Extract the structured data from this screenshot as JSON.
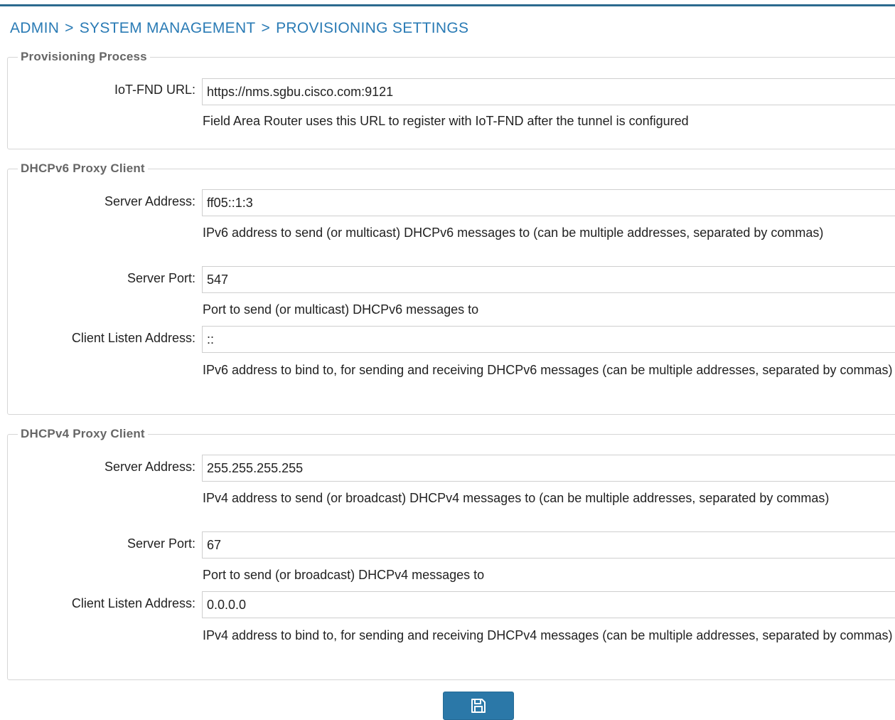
{
  "breadcrumb": {
    "items": [
      "ADMIN",
      "SYSTEM MANAGEMENT",
      "PROVISIONING SETTINGS"
    ],
    "separator": ">"
  },
  "provisioning": {
    "legend": "Provisioning Process",
    "iot_fnd_url": {
      "label": "IoT-FND URL:",
      "value": "https://nms.sgbu.cisco.com:9121",
      "help": "Field Area Router uses this URL to register with IoT-FND after the tunnel is configured"
    }
  },
  "dhcpv6": {
    "legend": "DHCPv6 Proxy Client",
    "server_address": {
      "label": "Server Address:",
      "value": "ff05::1:3",
      "help": "IPv6 address to send (or multicast) DHCPv6 messages to (can be multiple addresses, separated by commas)"
    },
    "server_port": {
      "label": "Server Port:",
      "value": "547",
      "help": "Port to send (or multicast) DHCPv6 messages to"
    },
    "client_listen_address": {
      "label": "Client Listen Address:",
      "value": "::",
      "help": "IPv6 address to bind to, for sending and receiving DHCPv6 messages (can be multiple addresses, separated by commas)"
    }
  },
  "dhcpv4": {
    "legend": "DHCPv4 Proxy Client",
    "server_address": {
      "label": "Server Address:",
      "value": "255.255.255.255",
      "help": "IPv4 address to send (or broadcast) DHCPv4 messages to (can be multiple addresses, separated by commas)"
    },
    "server_port": {
      "label": "Server Port:",
      "value": "67",
      "help": "Port to send (or broadcast) DHCPv4 messages to"
    },
    "client_listen_address": {
      "label": "Client Listen Address:",
      "value": "0.0.0.0",
      "help": "IPv4 address to bind to, for sending and receiving DHCPv4 messages (can be multiple addresses, separated by commas)"
    }
  },
  "save_button": {
    "icon": "floppy-disk-icon"
  },
  "colors": {
    "accent": "#2a7bb5",
    "button": "#2b78a8",
    "legend": "#666666"
  }
}
